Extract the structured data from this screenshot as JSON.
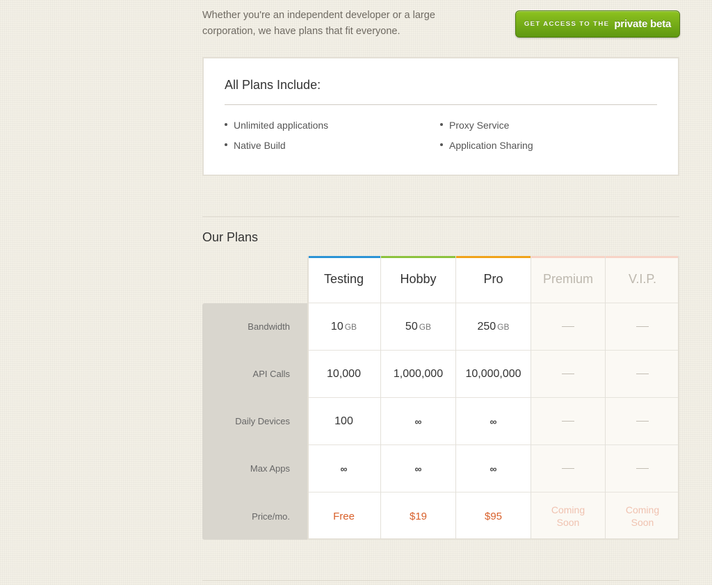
{
  "intro": {
    "line1": "Whether you're an independent developer or a large",
    "line2": "corporation, we have plans that fit everyone."
  },
  "beta_button": {
    "small": "GET ACCESS TO THE",
    "big": "private beta"
  },
  "includes": {
    "title": "All Plans Include:",
    "features": [
      "Unlimited applications",
      "Native Build",
      "Proxy Service",
      "Application Sharing"
    ]
  },
  "plans": {
    "title": "Our Plans",
    "row_labels": [
      "Bandwidth",
      "API Calls",
      "Daily Devices",
      "Max Apps",
      "Price/mo."
    ],
    "columns": [
      {
        "name": "Testing",
        "color": "#2b93d5",
        "bandwidth": "10",
        "bandwidth_unit": "GB",
        "api_calls": "10,000",
        "daily_devices": "100",
        "max_apps": "∞",
        "price": "Free"
      },
      {
        "name": "Hobby",
        "color": "#8cc23e",
        "bandwidth": "50",
        "bandwidth_unit": "GB",
        "api_calls": "1,000,000",
        "daily_devices": "∞",
        "max_apps": "∞",
        "price": "$19"
      },
      {
        "name": "Pro",
        "color": "#f0a31a",
        "bandwidth": "250",
        "bandwidth_unit": "GB",
        "api_calls": "10,000,000",
        "daily_devices": "∞",
        "max_apps": "∞",
        "price": "$95"
      },
      {
        "name": "Premium",
        "color": "#f7d3c6",
        "bandwidth": "—",
        "api_calls": "—",
        "daily_devices": "—",
        "max_apps": "—",
        "price_line1": "Coming",
        "price_line2": "Soon"
      },
      {
        "name": "V.I.P.",
        "color": "#f7d3c6",
        "bandwidth": "—",
        "api_calls": "—",
        "daily_devices": "—",
        "max_apps": "—",
        "price_line1": "Coming",
        "price_line2": "Soon"
      }
    ]
  }
}
